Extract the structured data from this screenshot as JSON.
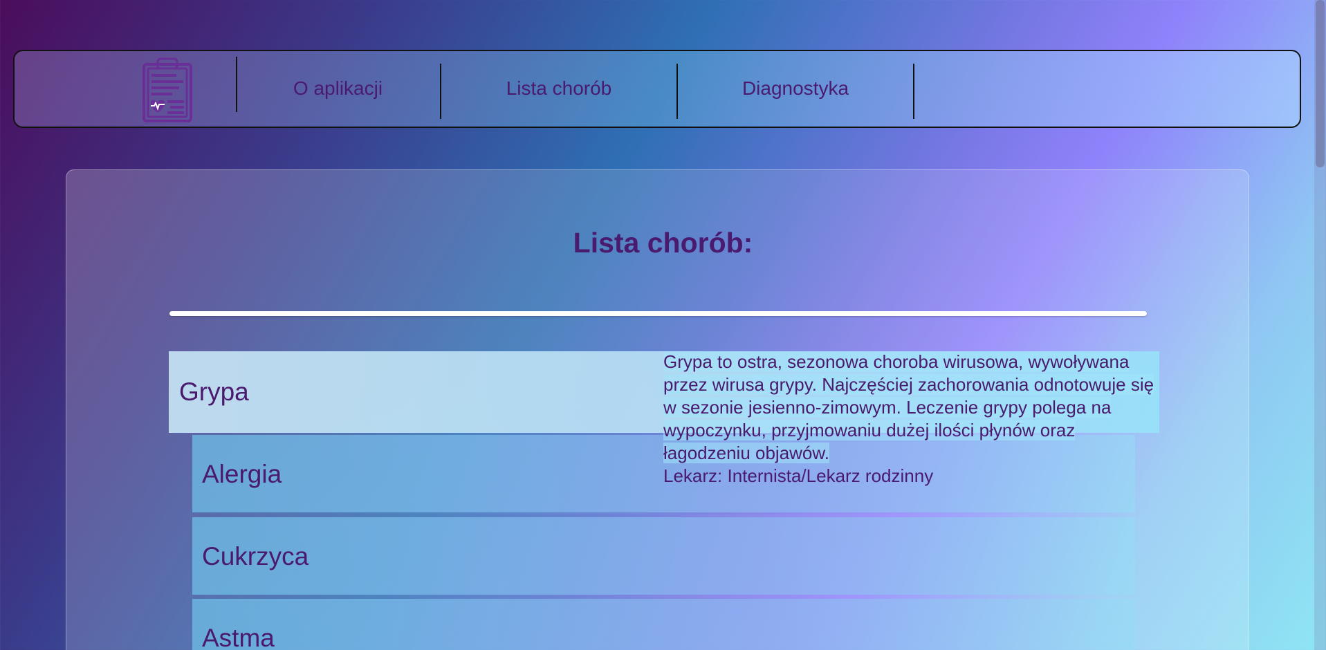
{
  "nav": {
    "logo_icon": "clipboard-heartbeat-icon",
    "links": [
      {
        "label": "O aplikacji"
      },
      {
        "label": "Lista chorób"
      },
      {
        "label": "Diagnostyka"
      }
    ]
  },
  "main": {
    "title": "Lista chorób:",
    "diseases": [
      {
        "name": "Grypa"
      },
      {
        "name": "Alergia"
      },
      {
        "name": "Cukrzyca"
      },
      {
        "name": "Astma"
      }
    ],
    "description": {
      "text": "Grypa to ostra, sezonowa choroba wirusowa, wywoływana przez wirusa grypy. Najczęściej zachorowania odnotowuje się w sezonie jesienno-zimowym. Leczenie grypy polega na wypoczynku, przyjmowaniu dużej ilości płynów oraz łagodzeniu objawów.",
      "doctor": "Lekarz: Internista/Lekarz rodzinny"
    }
  },
  "colors": {
    "text_accent": "#4a1a6e",
    "navbar_border": "#111111"
  }
}
